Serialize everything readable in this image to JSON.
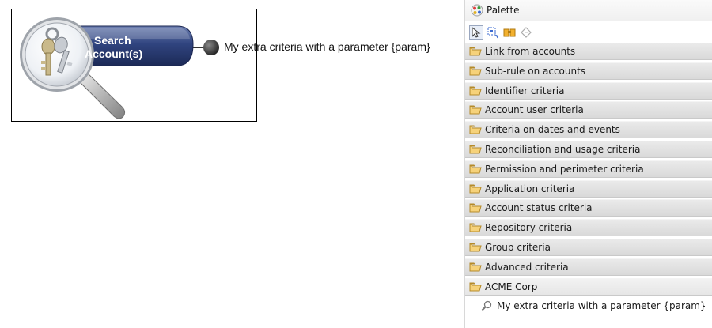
{
  "canvas": {
    "search_node": {
      "line1": "Search",
      "line2": "Account(s)"
    },
    "criteria_node": {
      "label": "My extra criteria with a parameter {param}"
    }
  },
  "palette": {
    "title": "Palette",
    "tools": [
      {
        "name": "select-tool-icon"
      },
      {
        "name": "marquee-tool-icon"
      },
      {
        "name": "note-tool-icon"
      },
      {
        "name": "connection-tool-icon"
      }
    ],
    "drawers": [
      {
        "label": "Link from accounts"
      },
      {
        "label": "Sub-rule on accounts"
      },
      {
        "label": "Identifier criteria"
      },
      {
        "label": "Account user criteria"
      },
      {
        "label": "Criteria on dates and events"
      },
      {
        "label": "Reconciliation and usage criteria"
      },
      {
        "label": "Permission and perimeter criteria"
      },
      {
        "label": "Application criteria"
      },
      {
        "label": "Account status criteria"
      },
      {
        "label": "Repository criteria"
      },
      {
        "label": "Group criteria"
      },
      {
        "label": "Advanced criteria"
      },
      {
        "label": "ACME Corp"
      }
    ],
    "open_drawer": {
      "entries": [
        {
          "label": "My extra criteria with a parameter {param}"
        }
      ]
    }
  },
  "colors": {
    "node_blue": "#2a3f7a",
    "drawer_bg": "#dedede",
    "folder": "#e8b84a"
  }
}
